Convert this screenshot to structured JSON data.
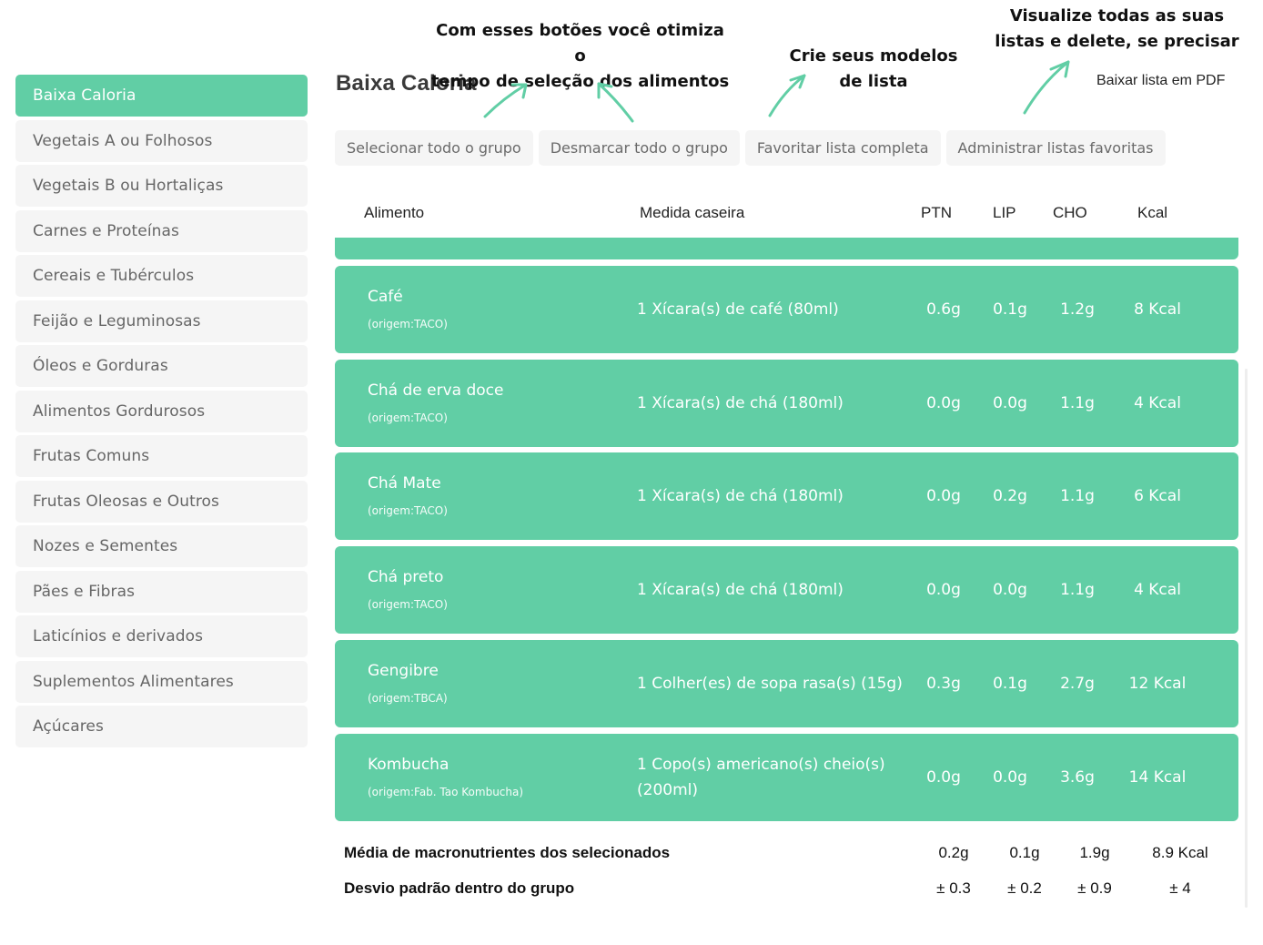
{
  "sidebar": {
    "items": [
      {
        "label": "Baixa Caloria",
        "active": true
      },
      {
        "label": "Vegetais A ou Folhosos"
      },
      {
        "label": "Vegetais B ou Hortaliças"
      },
      {
        "label": "Carnes e Proteínas"
      },
      {
        "label": "Cereais e Tubérculos"
      },
      {
        "label": "Feijão e Leguminosas"
      },
      {
        "label": "Óleos e Gorduras"
      },
      {
        "label": "Alimentos Gordurosos"
      },
      {
        "label": "Frutas Comuns"
      },
      {
        "label": "Frutas Oleosas e Outros"
      },
      {
        "label": "Nozes e Sementes"
      },
      {
        "label": "Pães e Fibras"
      },
      {
        "label": "Laticínios e derivados"
      },
      {
        "label": "Suplementos Alimentares"
      },
      {
        "label": "Açúcares"
      }
    ]
  },
  "header": {
    "title": "Baixa Caloria",
    "pdf_link": "Baixar lista em PDF"
  },
  "annotations": {
    "buttons_note_line1": "Com esses botões você otimiza o",
    "buttons_note_line2": "tempo de seleção dos alimentos",
    "models_note_line1": "Crie seus modelos",
    "models_note_line2": "de lista",
    "lists_note_line1": "Visualize todas as suas",
    "lists_note_line2": "listas e delete, se precisar",
    "arrow_color": "#61cea5"
  },
  "toolbar": {
    "select_all": "Selecionar todo o grupo",
    "deselect_all": "Desmarcar todo o grupo",
    "favorite_list": "Favoritar lista completa",
    "manage_favorites": "Administrar listas favoritas"
  },
  "table": {
    "columns": {
      "food": "Alimento",
      "measure": "Medida caseira",
      "ptn": "PTN",
      "lip": "LIP",
      "cho": "CHO",
      "kcal": "Kcal"
    },
    "rows": [
      {
        "name": "Café",
        "origin": "(origem:TACO)",
        "measure": "1 Xícara(s) de café (80ml)",
        "ptn": "0.6g",
        "lip": "0.1g",
        "cho": "1.2g",
        "kcal": "8 Kcal"
      },
      {
        "name": "Chá de erva doce",
        "origin": "(origem:TACO)",
        "measure": "1 Xícara(s) de chá (180ml)",
        "ptn": "0.0g",
        "lip": "0.0g",
        "cho": "1.1g",
        "kcal": "4 Kcal"
      },
      {
        "name": "Chá Mate",
        "origin": "(origem:TACO)",
        "measure": "1 Xícara(s) de chá (180ml)",
        "ptn": "0.0g",
        "lip": "0.2g",
        "cho": "1.1g",
        "kcal": "6 Kcal"
      },
      {
        "name": "Chá preto",
        "origin": "(origem:TACO)",
        "measure": "1 Xícara(s) de chá (180ml)",
        "ptn": "0.0g",
        "lip": "0.0g",
        "cho": "1.1g",
        "kcal": "4 Kcal"
      },
      {
        "name": "Gengibre",
        "origin": "(origem:TBCA)",
        "measure": "1 Colher(es) de sopa rasa(s) (15g)",
        "ptn": "0.3g",
        "lip": "0.1g",
        "cho": "2.7g",
        "kcal": "12 Kcal"
      },
      {
        "name": "Kombucha",
        "origin": "(origem:Fab. Tao Kombucha)",
        "measure": "1 Copo(s) americano(s) cheio(s) (200ml)",
        "ptn": "0.0g",
        "lip": "0.0g",
        "cho": "3.6g",
        "kcal": "14 Kcal"
      }
    ]
  },
  "summary": {
    "mean_label": "Média de macronutrientes dos selecionados",
    "mean": {
      "ptn": "0.2g",
      "lip": "0.1g",
      "cho": "1.9g",
      "kcal": "8.9 Kcal"
    },
    "sd_label": "Desvio padrão dentro do grupo",
    "sd": {
      "ptn": "± 0.3",
      "lip": "± 0.2",
      "cho": "± 0.9",
      "kcal": "± 4"
    }
  },
  "colors": {
    "accent": "#61cea5",
    "button_bg": "#f5f5f5",
    "button_text": "#6a6a6a"
  }
}
